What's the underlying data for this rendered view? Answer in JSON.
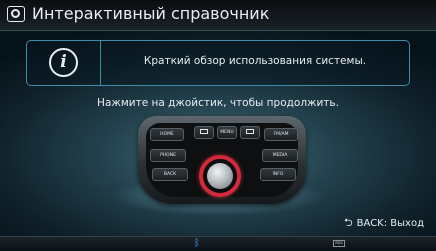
{
  "header": {
    "icon": "help-screen-icon",
    "title": "Интерактивный справочник"
  },
  "info": {
    "icon": "info-icon",
    "icon_glyph": "i",
    "text": "Краткий обзор использования системы."
  },
  "instruction": "Нажмите на джойстик, чтобы продолжить.",
  "controller": {
    "buttons": {
      "home": "HOME",
      "menu": "MENU",
      "fm_am": "FM/AM",
      "phone": "PHONE",
      "media": "MEDIA",
      "back": "BACK",
      "info": "INFO"
    },
    "knob": "joystick-knob",
    "accent_color": "#d12a3a"
  },
  "footer": {
    "back_label": "BACK: Выход",
    "back_icon": "back-arrow-icon"
  },
  "statusbar": {
    "bluetooth_icon": "bluetooth-icon",
    "bluetooth_color": "#3aa0ff",
    "chip_label": "RDS"
  },
  "colors": {
    "frame": "#3f8ba8",
    "background": "#22404c"
  }
}
